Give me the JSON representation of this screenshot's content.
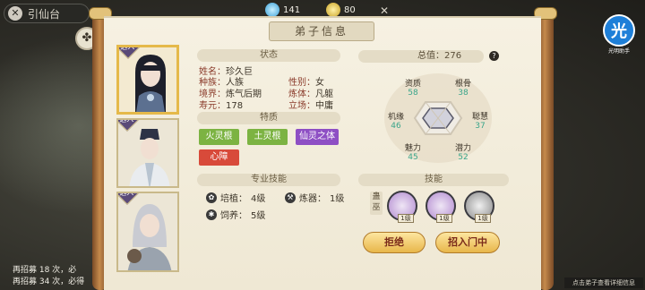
{
  "top": {
    "title": "引仙台",
    "currency": [
      {
        "icon": "spirit-stone-icon",
        "value": "141"
      },
      {
        "icon": "gold-coin-icon",
        "value": "80"
      }
    ],
    "logo_char": "光",
    "logo_sub": "光明助手"
  },
  "panel": {
    "title": "弟子信息",
    "status_head": "状态",
    "traits_head": "特质",
    "skills_head": "专业技能",
    "tech_head": "技能",
    "info": {
      "name": {
        "k": "姓名：",
        "v": "珍久巨"
      },
      "race": {
        "k": "种族：",
        "v": "人族"
      },
      "realm": {
        "k": "境界：",
        "v": "炼气后期"
      },
      "lifespan": {
        "k": "寿元：",
        "v": "178"
      },
      "gender": {
        "k": "性别：",
        "v": "女"
      },
      "body": {
        "k": "炼体：",
        "v": "凡躯"
      },
      "stance": {
        "k": "立场：",
        "v": "中庸"
      }
    },
    "traits": [
      {
        "label": "火灵根",
        "color": "#7cb342"
      },
      {
        "label": "土灵根",
        "color": "#7cb342"
      },
      {
        "label": "仙灵之体",
        "color": "#8e4fc4"
      },
      {
        "label": "心障",
        "color": "#d84a3a"
      }
    ],
    "skills": [
      {
        "label": "培植：",
        "level": "4级"
      },
      {
        "label": "炼器：",
        "level": "1级"
      },
      {
        "label": "饲养：",
        "level": "5级"
      }
    ],
    "total_label": "总值：",
    "total_value": "276",
    "stats": [
      {
        "name": "资质",
        "value": "58"
      },
      {
        "name": "根骨",
        "value": "38"
      },
      {
        "name": "机缘",
        "value": "46"
      },
      {
        "name": "聪慧",
        "value": "37"
      },
      {
        "name": "魅力",
        "value": "45"
      },
      {
        "name": "潜力",
        "value": "52"
      }
    ],
    "tech_badge": "蛊巫",
    "techs": [
      {
        "lv": "1级"
      },
      {
        "lv": "1级"
      },
      {
        "lv": "1级"
      }
    ],
    "buttons": {
      "reject": "拒绝",
      "recruit": "招入门中"
    }
  },
  "portraits": [
    {
      "tag": "选入",
      "label": "黑发女修"
    },
    {
      "tag": "选入",
      "label": "白衣男修"
    },
    {
      "tag": "选入",
      "label": "银发女修"
    }
  ],
  "bottom": {
    "line1": "再招募 18 次，必",
    "line2": "再招募 34 次，必得",
    "tip": "点击弟子查看详细信息"
  }
}
